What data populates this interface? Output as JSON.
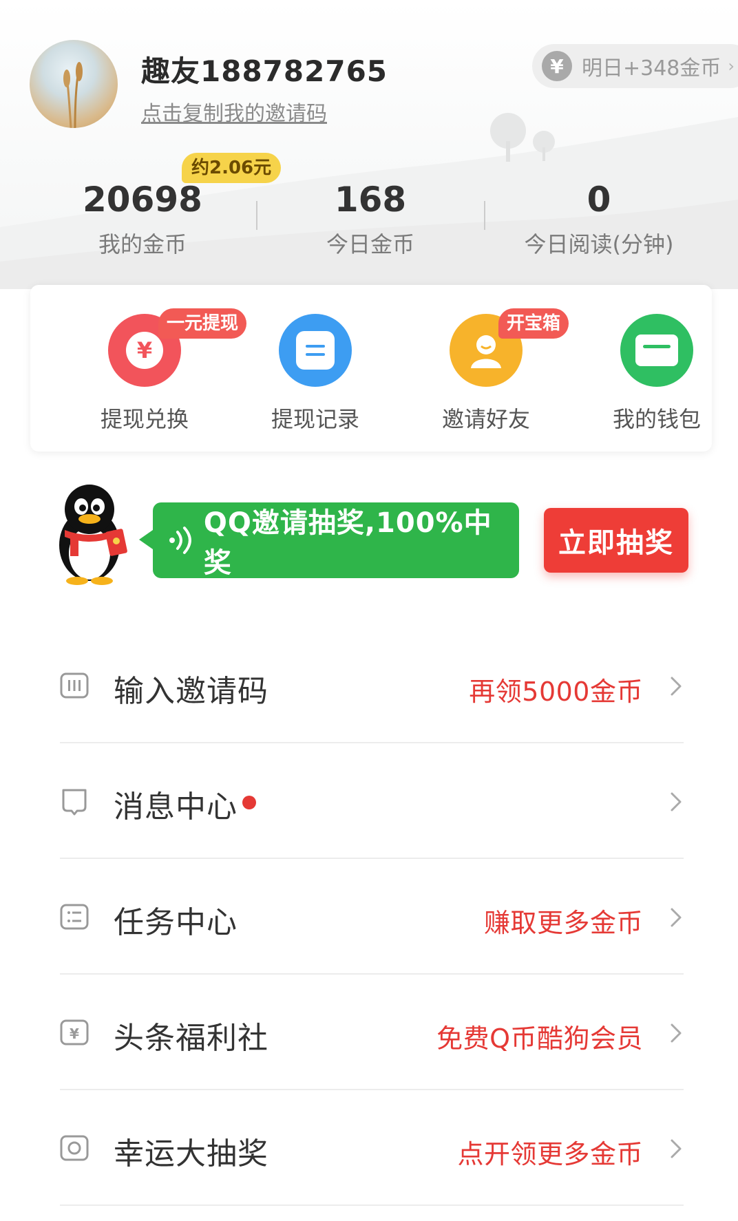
{
  "profile": {
    "username": "趣友188782765",
    "invite_link": "点击复制我的邀请码",
    "tomorrow_reward": "明日+348金币",
    "yen_symbol": "¥",
    "arrow": "›"
  },
  "stats": {
    "coins_value": "20698",
    "coins_label": "我的金币",
    "coins_cash": "约2.06元",
    "today_coins_value": "168",
    "today_coins_label": "今日金币",
    "today_read_value": "0",
    "today_read_label": "今日阅读(分钟)"
  },
  "actions": [
    {
      "label": "提现兑换",
      "badge": "一元提现",
      "icon": "yen-icon",
      "color": "#f2545b"
    },
    {
      "label": "提现记录",
      "badge": "",
      "icon": "record-icon",
      "color": "#3d9df2"
    },
    {
      "label": "邀请好友",
      "badge": "开宝箱",
      "icon": "person-icon",
      "color": "#f7b32b"
    },
    {
      "label": "我的钱包",
      "badge": "",
      "icon": "wallet-icon",
      "color": "#2fbf62"
    }
  ],
  "qq_banner": {
    "text": "QQ邀请抽奖,100%中奖",
    "button": "立即抽奖"
  },
  "menu": [
    {
      "label": "输入邀请码",
      "right": "再领5000金币",
      "icon": "invite-code-icon"
    },
    {
      "label": "消息中心",
      "right": "",
      "icon": "message-icon"
    },
    {
      "label": "任务中心",
      "right": "赚取更多金币",
      "icon": "task-list-icon"
    },
    {
      "label": "头条福利社",
      "right": "免费Q币酷狗会员",
      "icon": "yen-icon"
    },
    {
      "label": "幸运大抽奖",
      "right": "点开领更多金币",
      "icon": "lottery-icon"
    }
  ],
  "colors": {
    "accent_red": "#e53935",
    "green": "#2fb54a",
    "coin_tag": "#f6d34a"
  }
}
